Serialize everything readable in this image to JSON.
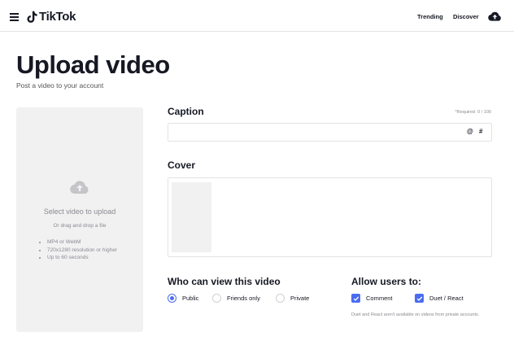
{
  "header": {
    "logo_text": "TikTok",
    "nav": {
      "trending": "Trending",
      "discover": "Discover"
    }
  },
  "page": {
    "title": "Upload video",
    "subtitle": "Post a video to your account"
  },
  "dropzone": {
    "title": "Select video to upload",
    "subtitle": "Or drag and drop a file",
    "requirements": [
      "MP4 or WebM",
      "720x1280 resolution or higher",
      "Up to 60 seconds"
    ]
  },
  "caption": {
    "label": "Caption",
    "required_note": "*Required",
    "counter": "0 / 100",
    "value": "",
    "mention_symbol": "@",
    "hashtag_symbol": "#"
  },
  "cover": {
    "label": "Cover"
  },
  "visibility": {
    "label": "Who can view this video",
    "selected": "Public",
    "options": [
      "Public",
      "Friends only",
      "Private"
    ]
  },
  "allow": {
    "label": "Allow users to:",
    "options": [
      {
        "label": "Comment",
        "checked": true
      },
      {
        "label": "Duet / React",
        "checked": true
      }
    ],
    "note": "Duet and React aren't available on videos from private accounts."
  },
  "colors": {
    "accent": "#4a6cf0",
    "text": "#161823",
    "muted": "#8a8b91",
    "panel": "#f1f1f2"
  }
}
